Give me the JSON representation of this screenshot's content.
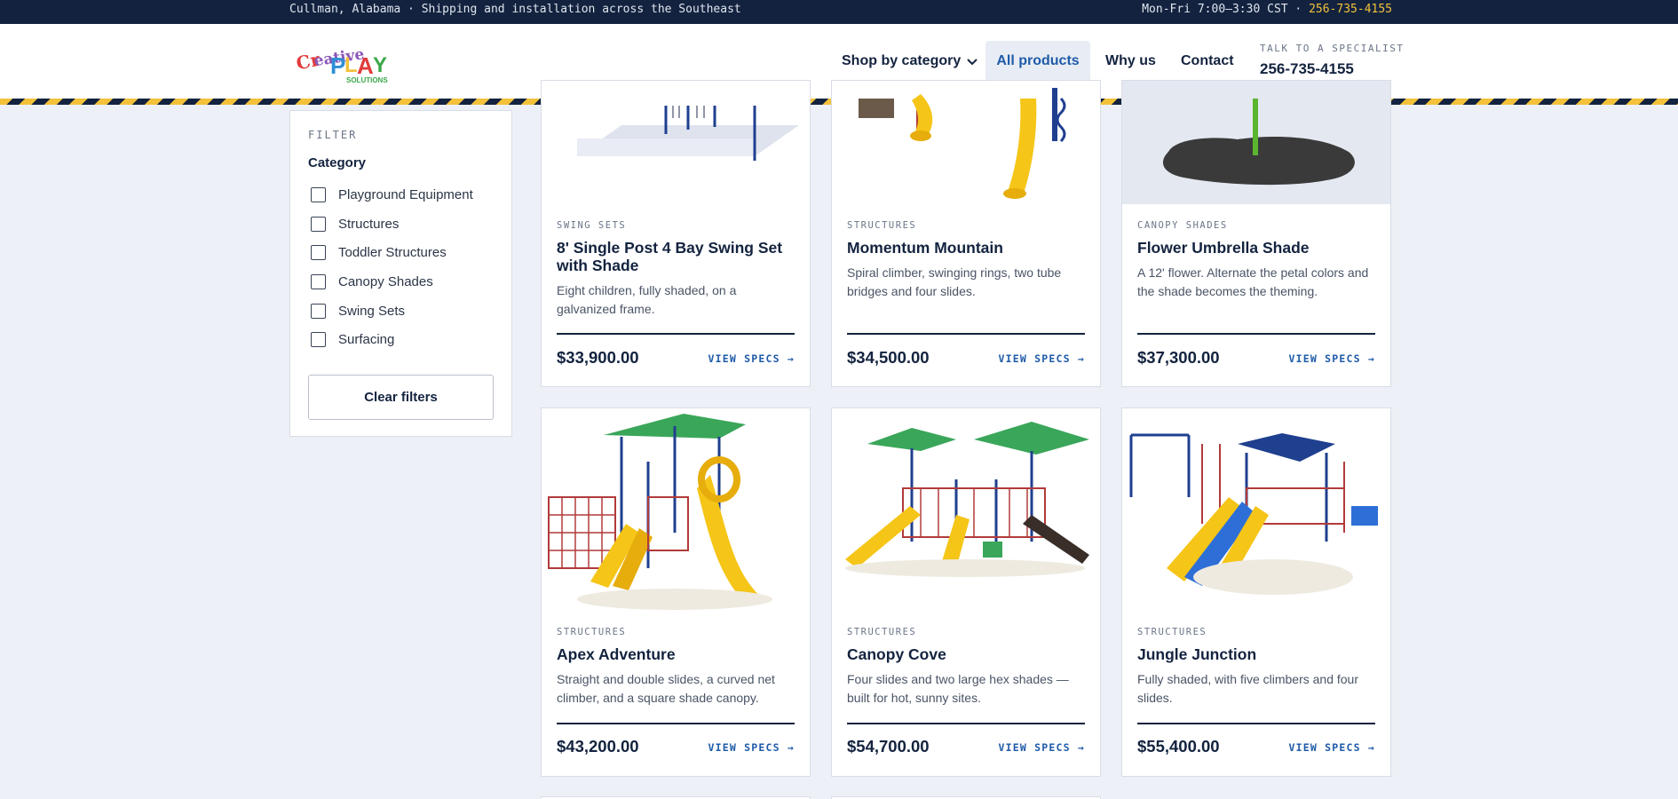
{
  "topbar": {
    "left_text": "Cullman, Alabama · Shipping and installation across the Southeast",
    "hours": "Mon-Fri 7:00–3:30 CST · ",
    "phone": "256-735-4155"
  },
  "header": {
    "logo_text": "Creative Play Solutions",
    "nav": {
      "shop": "Shop by category",
      "all": "All products",
      "why": "Why us",
      "contact": "Contact"
    },
    "specialist_label": "TALK TO A SPECIALIST",
    "specialist_phone": "256-735-4155"
  },
  "filter": {
    "title": "FILTER",
    "category_heading": "Category",
    "options": [
      "Playground Equipment",
      "Structures",
      "Toddler Structures",
      "Canopy Shades",
      "Swing Sets",
      "Surfacing"
    ],
    "clear_label": "Clear filters"
  },
  "products": [
    {
      "category": "SWING SETS",
      "name": "8' Single Post 4 Bay Swing Set with Shade",
      "desc": "Eight children, fully shaded, on a galvanized frame.",
      "price": "$33,900.00",
      "specs": "VIEW SPECS →"
    },
    {
      "category": "STRUCTURES",
      "name": "Momentum Mountain",
      "desc": "Spiral climber, swinging rings, two tube bridges and four slides.",
      "price": "$34,500.00",
      "specs": "VIEW SPECS →"
    },
    {
      "category": "CANOPY SHADES",
      "name": "Flower Umbrella Shade",
      "desc": "A 12' flower. Alternate the petal colors and the shade becomes the theming.",
      "price": "$37,300.00",
      "specs": "VIEW SPECS →"
    },
    {
      "category": "STRUCTURES",
      "name": "Apex Adventure",
      "desc": "Straight and double slides, a curved net climber, and a square shade canopy.",
      "price": "$43,200.00",
      "specs": "VIEW SPECS →"
    },
    {
      "category": "STRUCTURES",
      "name": "Canopy Cove",
      "desc": "Four slides and two large hex shades — built for hot, sunny sites.",
      "price": "$54,700.00",
      "specs": "VIEW SPECS →"
    },
    {
      "category": "STRUCTURES",
      "name": "Jungle Junction",
      "desc": "Fully shaded, with five climbers and four slides.",
      "price": "$55,400.00",
      "specs": "VIEW SPECS →"
    }
  ],
  "colors": {
    "navy": "#13233f",
    "accent_yellow": "#f3c13a",
    "link_blue": "#1f5ba8",
    "page_bg": "#edf0f6"
  }
}
